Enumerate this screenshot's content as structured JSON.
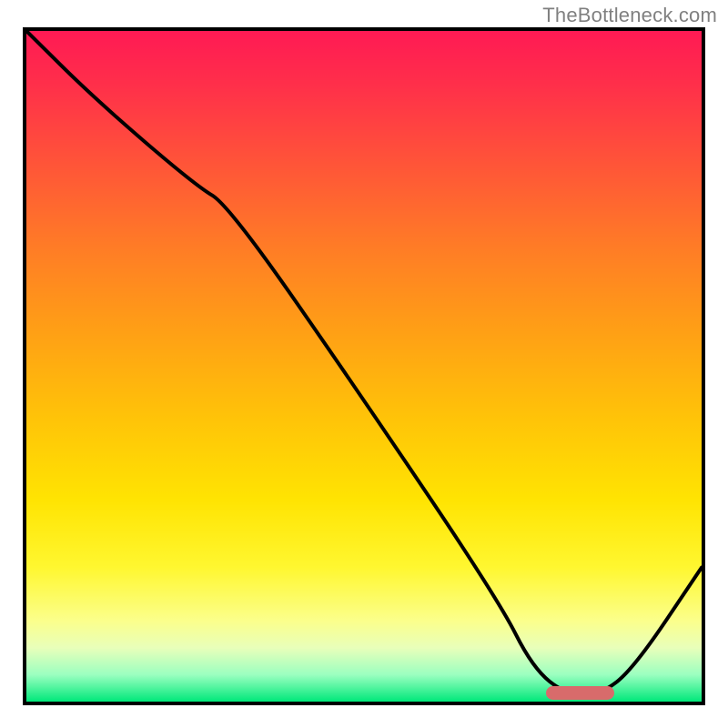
{
  "attribution": "TheBottleneck.com",
  "chart_data": {
    "type": "line",
    "title": "",
    "xlabel": "",
    "ylabel": "",
    "x_range": [
      0,
      100
    ],
    "y_range": [
      0,
      100
    ],
    "series": [
      {
        "name": "bottleneck-curve",
        "x": [
          0,
          10,
          25,
          30,
          50,
          70,
          75,
          80,
          85,
          90,
          100
        ],
        "y": [
          100,
          90,
          77,
          74,
          45,
          15,
          5,
          1,
          1,
          5,
          20
        ]
      }
    ],
    "optimal_marker": {
      "x_start": 77,
      "x_end": 87,
      "y": 0.7
    },
    "gradient_stops": [
      {
        "pos": 0,
        "color": "#ff1a54"
      },
      {
        "pos": 8,
        "color": "#ff2f4a"
      },
      {
        "pos": 20,
        "color": "#ff5538"
      },
      {
        "pos": 33,
        "color": "#ff7e25"
      },
      {
        "pos": 45,
        "color": "#ffa015"
      },
      {
        "pos": 58,
        "color": "#ffc408"
      },
      {
        "pos": 70,
        "color": "#ffe402"
      },
      {
        "pos": 80,
        "color": "#fff730"
      },
      {
        "pos": 88,
        "color": "#fbff8c"
      },
      {
        "pos": 92,
        "color": "#e8ffba"
      },
      {
        "pos": 96,
        "color": "#9bffc0"
      },
      {
        "pos": 100,
        "color": "#00e87a"
      }
    ]
  }
}
